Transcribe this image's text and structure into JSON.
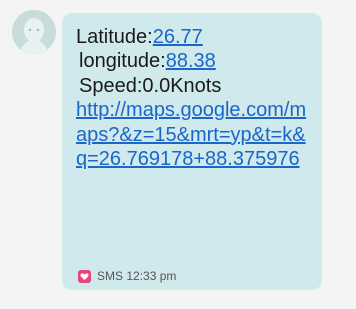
{
  "message": {
    "lat_label": "Latitude:",
    "lat_value": "26.77",
    "lon_label": "longitude:",
    "lon_value": "88.38",
    "speed_text": "Speed:0.0Knots",
    "url": "http://maps.google.com/maps?&z=15&mrt=yp&t=k&q=26.769178+88.375976"
  },
  "meta": {
    "channel": "SMS",
    "time": "12:33 pm"
  },
  "icons": {
    "avatar": "contact-avatar-icon",
    "sms": "heart-sms-icon"
  },
  "colors": {
    "bubble": "#cfe9ec",
    "link": "#1a67c9",
    "sms_icon": "#e8457a"
  }
}
